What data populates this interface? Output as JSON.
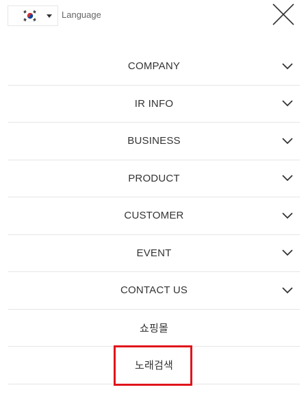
{
  "language": {
    "label": "Language",
    "flag": "korea-flag-icon",
    "caret": "caret-down-icon"
  },
  "close_icon": "close-icon",
  "menu": {
    "items": [
      {
        "label": "COMPANY",
        "has_submenu": true
      },
      {
        "label": "IR INFO",
        "has_submenu": true
      },
      {
        "label": "BUSINESS",
        "has_submenu": true
      },
      {
        "label": "PRODUCT",
        "has_submenu": true
      },
      {
        "label": "CUSTOMER",
        "has_submenu": true
      },
      {
        "label": "EVENT",
        "has_submenu": true
      },
      {
        "label": "CONTACT US",
        "has_submenu": true
      },
      {
        "label": "쇼핑몰",
        "has_submenu": false
      },
      {
        "label": "노래검색",
        "has_submenu": false
      }
    ]
  },
  "colors": {
    "highlight_border": "#e0141b",
    "divider": "#e5e5e5",
    "text": "#333333"
  }
}
